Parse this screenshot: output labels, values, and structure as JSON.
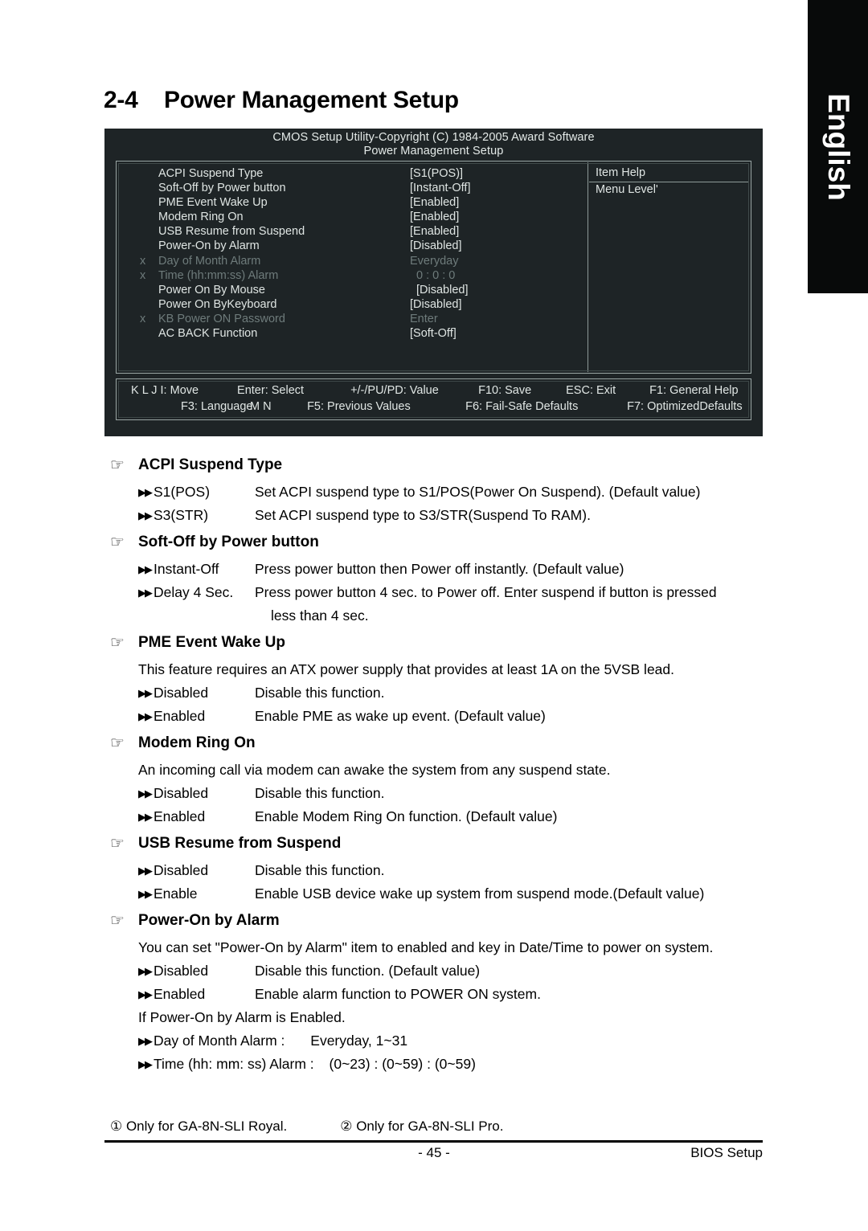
{
  "language_tab": {
    "label": "English"
  },
  "section": {
    "number": "2-4",
    "title": "Power Management Setup"
  },
  "bios": {
    "header_line1": "CMOS Setup Utility-Copyright (C) 1984-2005 Award Software",
    "header_line2": "Power Management Setup",
    "rows": [
      {
        "x": "",
        "label": "ACPI Suspend Type",
        "value": "[S1(POS)]",
        "dim": false
      },
      {
        "x": "",
        "label": "Soft-Off by Power button",
        "value": "[Instant-Off]",
        "dim": false
      },
      {
        "x": "",
        "label": "PME Event Wake Up",
        "value": "[Enabled]",
        "dim": false
      },
      {
        "x": "",
        "label": "Modem Ring On",
        "value": "[Enabled]",
        "dim": false
      },
      {
        "x": "",
        "label": "USB Resume from Suspend",
        "value": "[Enabled]",
        "dim": false
      },
      {
        "x": "",
        "label": "Power-On by Alarm",
        "value": "[Disabled]",
        "dim": false
      },
      {
        "x": "x",
        "label": "Day of Month Alarm",
        "value": "Everyday",
        "dim": true
      },
      {
        "x": "x",
        "label": "Time (hh:mm:ss) Alarm",
        "value": "0 : 0 : 0",
        "dim": true
      },
      {
        "x": "",
        "label": "Power On By Mouse",
        "value": "[Disabled]",
        "dim": false
      },
      {
        "x": "",
        "label": "Power On ByKeyboard",
        "value": "[Disabled]",
        "dim": false
      },
      {
        "x": "x",
        "label": "KB Power ON Password",
        "value": "Enter",
        "dim": true
      },
      {
        "x": "",
        "label": "AC BACK Function",
        "value": "[Soft-Off]",
        "dim": false
      }
    ],
    "help": {
      "title": "Item Help",
      "menu_level": "Menu Level'"
    },
    "footer": {
      "line1": [
        "K L J I: Move",
        "Enter: Select",
        "+/-/PU/PD: Value",
        "F10: Save",
        "ESC: Exit",
        "F1: General Help"
      ],
      "line2": [
        "F3: Language",
        "M N",
        "F5: Previous Values",
        "F6: Fail-Safe Defaults",
        "F7: OptimizedDefaults"
      ]
    }
  },
  "glyphs": {
    "hand": "☞",
    "arrow": "▶▶"
  },
  "sections": [
    {
      "heading": "ACPI Suspend Type",
      "note": null,
      "options": [
        {
          "name": "S1(POS)",
          "desc": "Set ACPI suspend type to S1/POS(Power On Suspend). (Default value)"
        },
        {
          "name": "S3(STR)",
          "desc": "Set ACPI suspend type to S3/STR(Suspend To RAM)."
        }
      ],
      "cont": null
    },
    {
      "heading": "Soft-Off by Power button",
      "note": null,
      "options": [
        {
          "name": "Instant-Off",
          "desc": "Press power button then Power off instantly. (Default value)"
        },
        {
          "name": "Delay 4 Sec.",
          "desc": "Press power button 4 sec. to Power off. Enter suspend if button is pressed"
        }
      ],
      "cont": "less than 4 sec."
    },
    {
      "heading": "PME Event Wake Up",
      "note": "This feature requires an ATX power supply that provides at least 1A on the 5VSB lead.",
      "options": [
        {
          "name": "Disabled",
          "desc": "Disable this function."
        },
        {
          "name": "Enabled",
          "desc": "Enable PME as wake up event. (Default value)"
        }
      ],
      "cont": null
    },
    {
      "heading": "Modem Ring On",
      "note": "An incoming call via modem can awake the system from any suspend state.",
      "options": [
        {
          "name": "Disabled",
          "desc": "Disable this function."
        },
        {
          "name": "Enabled",
          "desc": "Enable Modem Ring On function. (Default value)"
        }
      ],
      "cont": null
    },
    {
      "heading": "USB Resume from Suspend",
      "note": null,
      "options": [
        {
          "name": "Disabled",
          "desc": "Disable this function."
        },
        {
          "name": "Enable",
          "desc": "Enable USB device wake up system from suspend mode.(Default value)"
        }
      ],
      "cont": null
    },
    {
      "heading": "Power-On by Alarm",
      "note": "You can set \"Power-On by Alarm\" item to enabled and key in Date/Time to power on system.",
      "options": [
        {
          "name": "Disabled",
          "desc": "Disable this function. (Default value)"
        },
        {
          "name": "Enabled",
          "desc": "Enable alarm function to POWER ON system."
        }
      ],
      "cont": "If Power-On by Alarm is Enabled.",
      "plain_options": [
        {
          "name": "Day of Month Alarm :",
          "desc": "Everyday, 1~31"
        },
        {
          "name": "Time (hh: mm: ss) Alarm :",
          "desc": "(0~23) : (0~59) : (0~59)"
        }
      ]
    }
  ],
  "footer": {
    "note1": "① Only for GA-8N-SLI Royal.",
    "note2": "② Only for GA-8N-SLI Pro.",
    "page_number": "- 45 -",
    "right_label": "BIOS Setup"
  }
}
